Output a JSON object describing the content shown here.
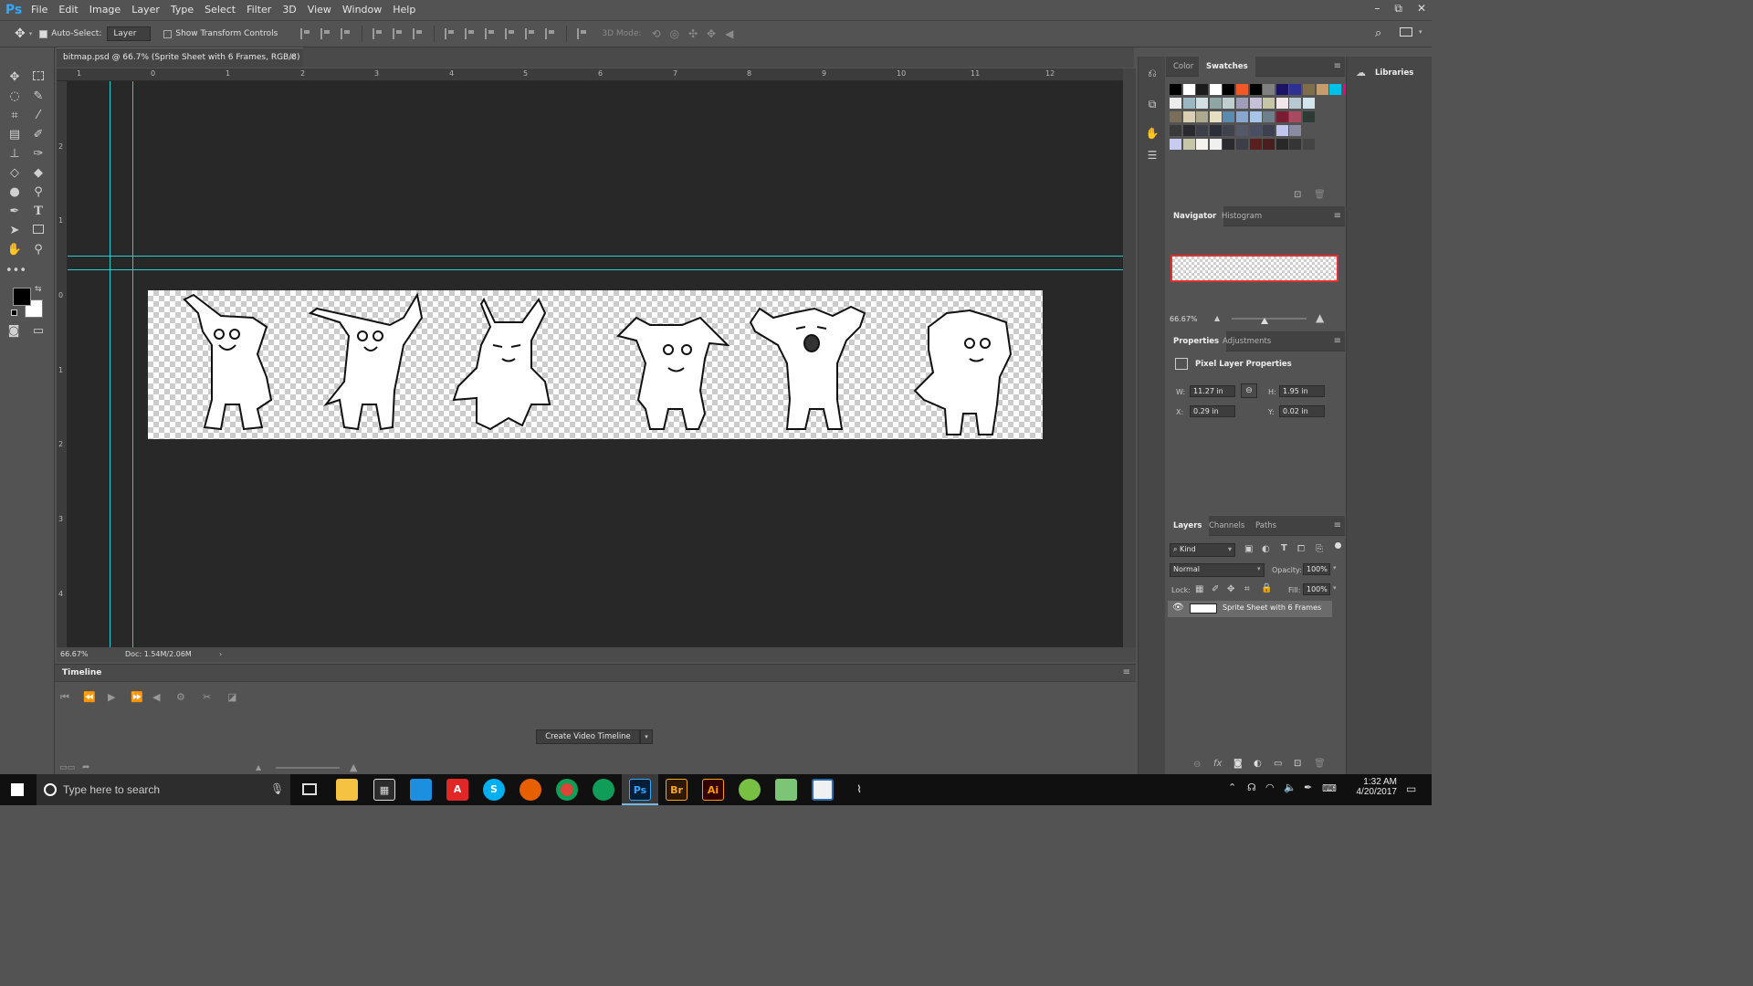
{
  "app": {
    "logo": "Ps",
    "menu": [
      "File",
      "Edit",
      "Image",
      "Layer",
      "Type",
      "Select",
      "Filter",
      "3D",
      "View",
      "Window",
      "Help"
    ],
    "window_controls": [
      "–",
      "⧉",
      "✕"
    ]
  },
  "options_bar": {
    "auto_select_label": "Auto-Select:",
    "auto_select_value": "Layer",
    "show_transform_label": "Show Transform Controls",
    "mode_3d_label": "3D Mode:"
  },
  "document": {
    "tab_title": "bitmap.psd @ 66.7% (Sprite Sheet with 6 Frames, RGB/8)",
    "tab_close": "×",
    "ruler_top_labels": [
      "1",
      "0",
      "1",
      "2",
      "3",
      "4",
      "5",
      "6",
      "7",
      "8",
      "9",
      "10",
      "11",
      "12"
    ],
    "ruler_left_labels": [
      "2",
      "1",
      "0",
      "1",
      "2",
      "3",
      "4"
    ]
  },
  "status": {
    "zoom": "66.67%",
    "doc_size": "Doc: 1.54M/2.06M"
  },
  "timeline": {
    "title": "Timeline",
    "create_button": "Create Video Timeline"
  },
  "panels": {
    "color_tab": "Color",
    "swatches_tab": "Swatches",
    "navigator_tab": "Navigator",
    "histogram_tab": "Histogram",
    "navigator_zoom": "66.67%",
    "properties_tab": "Properties",
    "adjustments_tab": "Adjustments",
    "properties_heading": "Pixel Layer Properties",
    "w_label": "W:",
    "w_value": "11.27 in",
    "h_label": "H:",
    "h_value": "1.95 in",
    "x_label": "X:",
    "x_value": "0.29 in",
    "y_label": "Y:",
    "y_value": "0.02 in",
    "layers_tab": "Layers",
    "channels_tab": "Channels",
    "paths_tab": "Paths",
    "kind_filter": "Kind",
    "blend_mode": "Normal",
    "opacity_label": "Opacity:",
    "opacity_value": "100%",
    "lock_label": "Lock:",
    "fill_label": "Fill:",
    "fill_value": "100%",
    "layer_name": "Sprite Sheet with 6 Frames",
    "libraries": "Libraries"
  },
  "swatch_colors": [
    [
      "#000000",
      "#ffffff",
      "#1c1c1c",
      "#ffffff",
      "#000000",
      "#f15a24",
      "#000000",
      "#808080",
      "#1b1464",
      "#2e3192",
      "#7f6d4b",
      "#c69c6d",
      "#00c2e8",
      "#ec008c",
      "#f7ef6a"
    ],
    [
      "#ececec",
      "#9ab7c2",
      "#d2e0e3",
      "#8fa7a4",
      "#bfcfd0",
      "#9e9eb8",
      "#c7c0d6",
      "#c5c5a8",
      "#f2e6ea",
      "#b8c9d4",
      "#d0e6ec"
    ],
    [
      "#7a6e5a",
      "#d8d0b0",
      "#aea98e",
      "#e5dfbf",
      "#5a8ab0",
      "#88a6cf",
      "#a8c4e6",
      "#6e7e8a",
      "#7a1e34",
      "#a84a60",
      "#2e3b35"
    ],
    [
      "#3a3a3a",
      "#2a2a2e",
      "#3c4048",
      "#2c2f38",
      "#40434e",
      "#545868",
      "#4a4e62",
      "#3e4050",
      "#c2c6ee",
      "#8a8aa0"
    ],
    [
      "#c8caf0",
      "#c8c4a8",
      "#f4f2ec",
      "#f0f0f0",
      "#2a2a30",
      "#3e3e48",
      "#5a2020",
      "#4a1e1e",
      "#282828",
      "#353535",
      "#444444"
    ]
  ],
  "taskbar": {
    "search_placeholder": "Type here to search",
    "time": "1:32 AM",
    "date": "4/20/2017",
    "apps": [
      "Br",
      "Ai",
      "Ps"
    ]
  }
}
